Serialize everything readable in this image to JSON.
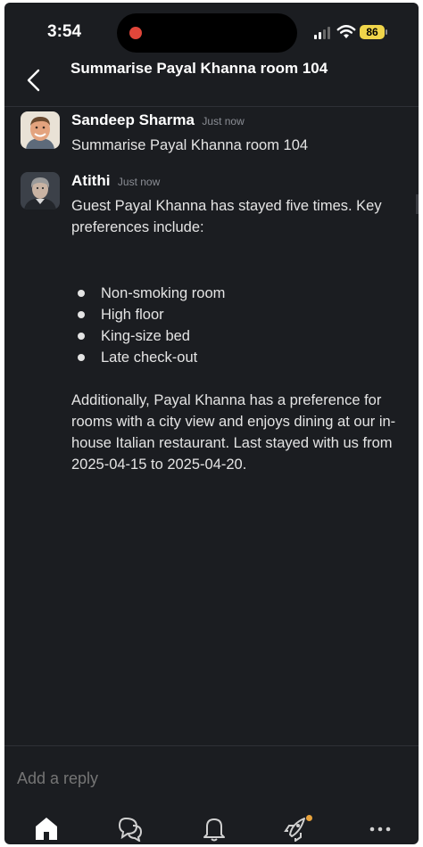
{
  "status_bar": {
    "time": "3:54",
    "battery": "86",
    "colors": {
      "battery": "#f0d54a",
      "recording": "#e0463a"
    }
  },
  "header": {
    "back_icon": "chevron-left-icon",
    "title": "Summarise Payal Khanna room 104"
  },
  "messages": [
    {
      "sender": "Sandeep Sharma",
      "timestamp": "Just now",
      "text": "Summarise Payal Khanna room 104"
    },
    {
      "sender": "Atithi",
      "timestamp": "Just now",
      "intro": "Guest Payal Khanna has stayed five times. Key  preferences include:",
      "preferences": [
        "Non-smoking room",
        "High floor",
        "King-size bed",
        "Late check-out"
      ],
      "closing": "Additionally, Payal Khanna has a preference for rooms with a city view and enjoys dining at our in-house Italian restaurant. Last stayed with us from 2025-04-15 to 2025-04-20."
    }
  ],
  "reply": {
    "placeholder": "Add a reply"
  },
  "bottom_nav": [
    {
      "icon": "home-icon"
    },
    {
      "icon": "dms-icon"
    },
    {
      "icon": "bell-icon"
    },
    {
      "icon": "rocket-icon",
      "badge_color": "#e8a33d"
    },
    {
      "icon": "more-icon"
    }
  ],
  "colors": {
    "background": "#1b1d21",
    "text": "#e4e4e4",
    "muted": "#8b8e95"
  }
}
